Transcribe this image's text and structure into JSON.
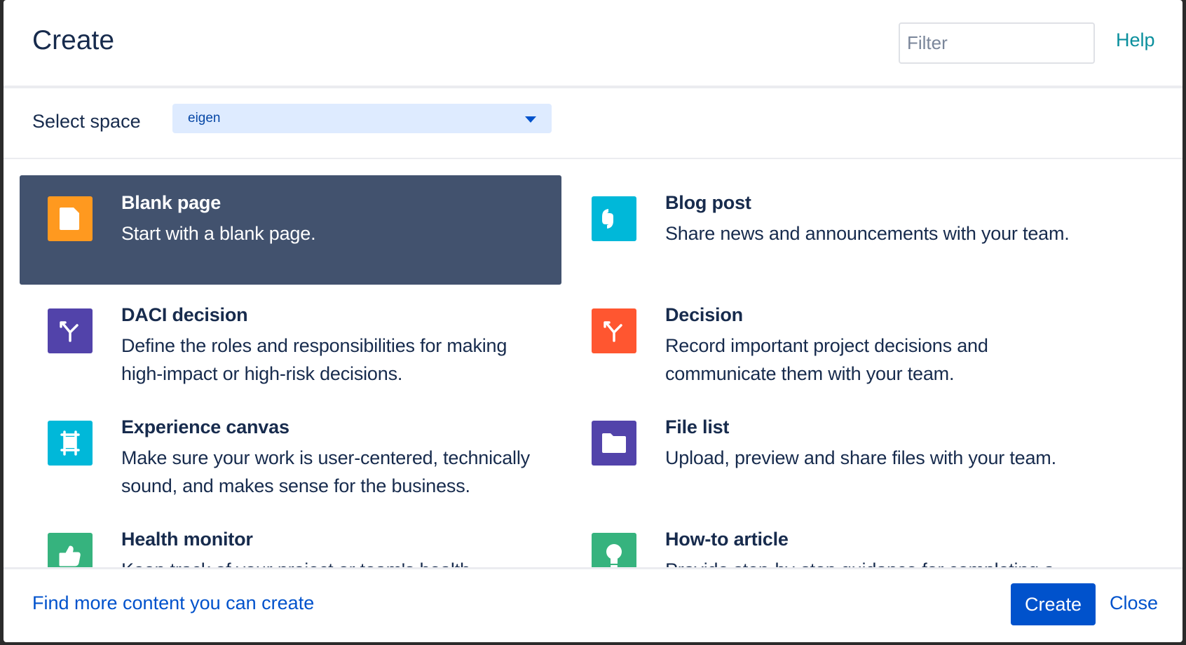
{
  "dialog": {
    "title": "Create",
    "filter_placeholder": "Filter",
    "help_label": "Help"
  },
  "space": {
    "label": "Select space",
    "selected": "eigen"
  },
  "templates": [
    {
      "name": "Blank page",
      "description": "Start with a blank page.",
      "icon": "blank-page-icon",
      "color": "#ff991f",
      "selected": true
    },
    {
      "name": "Blog post",
      "description": "Share news and announcements with your team.",
      "icon": "quote-icon",
      "color": "#00b8d9",
      "selected": false
    },
    {
      "name": "DACI decision",
      "description": "Define the roles and responsibilities for making high-impact or high-risk decisions.",
      "icon": "fork-icon",
      "color": "#5243aa",
      "selected": false
    },
    {
      "name": "Decision",
      "description": "Record important project decisions and communicate them with your team.",
      "icon": "fork-icon",
      "color": "#ff5630",
      "selected": false
    },
    {
      "name": "Experience canvas",
      "description": "Make sure your work is user-centered, technically sound, and makes sense for the business.",
      "icon": "easel-icon",
      "color": "#00b8d9",
      "selected": false
    },
    {
      "name": "File list",
      "description": "Upload, preview and share files with your team.",
      "icon": "folder-icon",
      "color": "#5243aa",
      "selected": false
    },
    {
      "name": "Health monitor",
      "description": "Keep track of your project or team's health",
      "icon": "thumbs-up-icon",
      "color": "#36b37e",
      "selected": false
    },
    {
      "name": "How-to article",
      "description": "Provide step-by-step guidance for completing a",
      "icon": "lightbulb-icon",
      "color": "#36b37e",
      "selected": false
    }
  ],
  "footer": {
    "find_more_label": "Find more content you can create",
    "create_label": "Create",
    "close_label": "Close"
  }
}
